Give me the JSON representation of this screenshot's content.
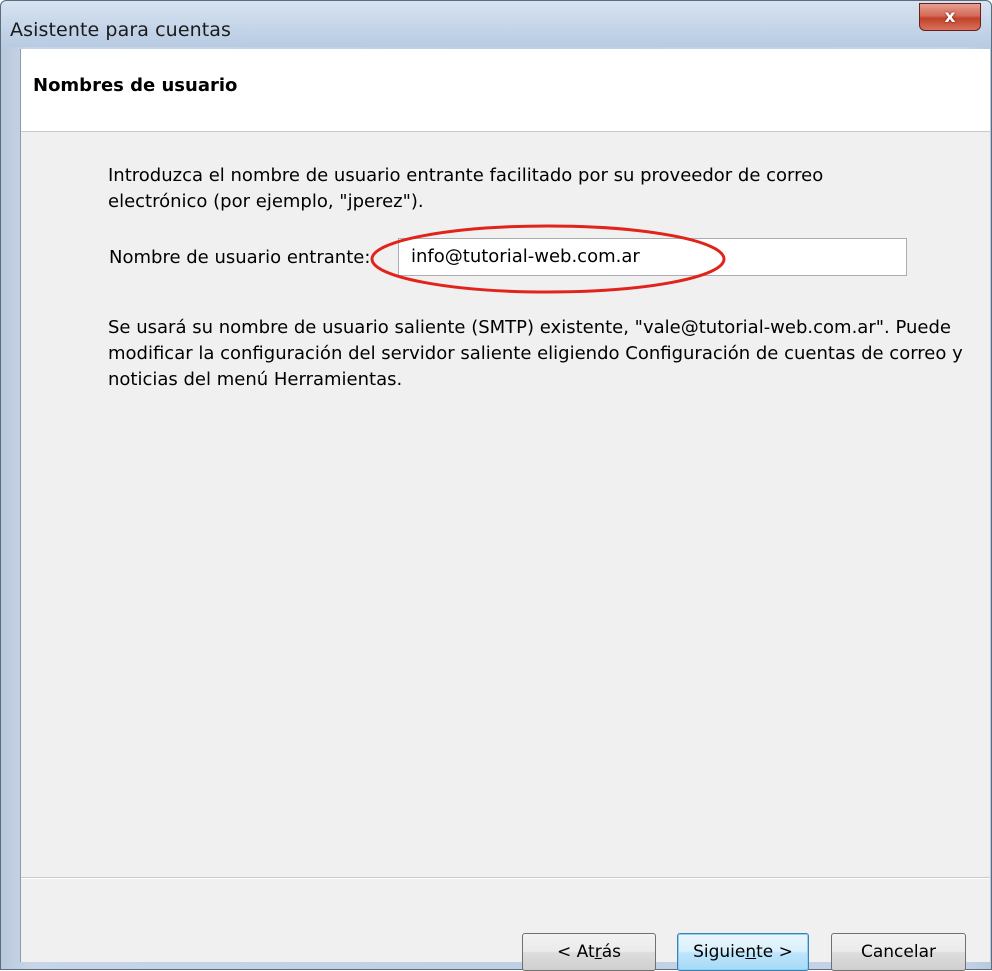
{
  "window": {
    "title": "Asistente para cuentas",
    "close_label": "x"
  },
  "header": {
    "title": "Nombres de usuario"
  },
  "body": {
    "intro": "Introduzca el nombre de usuario entrante facilitado por su proveedor de correo electrónico (por ejemplo, \"jperez\").",
    "incoming_label": "Nombre de usuario entrante:",
    "incoming_value": "info@tutorial-web.com.ar",
    "smtp_note": "Se usará su nombre de usuario saliente (SMTP) existente, \"vale@tutorial-web.com.ar\". Puede modificar la configuración del servidor saliente eligiendo Configuración de cuentas de correo y noticias del menú Herramientas."
  },
  "buttons": {
    "back": {
      "before": "< At",
      "accel": "r",
      "after": "ás"
    },
    "next": {
      "before": "Siguie",
      "accel": "n",
      "after": "te >"
    },
    "cancel": "Cancelar"
  },
  "colors": {
    "highlight_ellipse": "#e0231b",
    "dialog_background": "#f0f0f0",
    "header_background": "#ffffff"
  }
}
